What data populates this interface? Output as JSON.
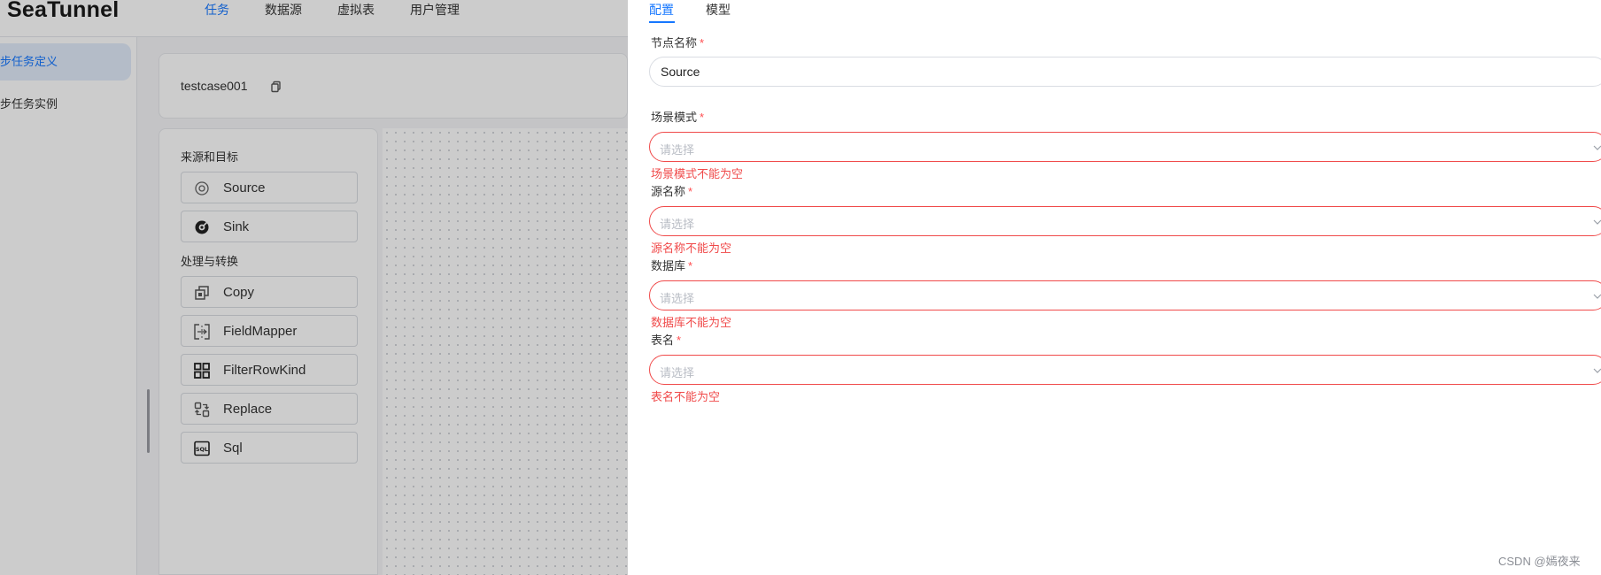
{
  "app": {
    "logo": "SeaTunnel",
    "nav": [
      {
        "label": "任务",
        "active": true
      },
      {
        "label": "数据源",
        "active": false
      },
      {
        "label": "虚拟表",
        "active": false
      },
      {
        "label": "用户管理",
        "active": false
      }
    ],
    "sidebar": [
      {
        "label": "同步任务定义",
        "active": true
      },
      {
        "label": "同步任务实例",
        "active": false
      }
    ],
    "task_name": "testcase001",
    "palette": {
      "group1": "来源和目标",
      "group2": "处理与转换",
      "nodes": [
        {
          "label": "Source",
          "icon": "source-icon"
        },
        {
          "label": "Sink",
          "icon": "sink-icon"
        },
        {
          "label": "Copy",
          "icon": "copy-icon"
        },
        {
          "label": "FieldMapper",
          "icon": "field-mapper-icon"
        },
        {
          "label": "FilterRowKind",
          "icon": "grid-icon"
        },
        {
          "label": "Replace",
          "icon": "replace-icon"
        },
        {
          "label": "Sql",
          "icon": "sql-icon"
        }
      ]
    }
  },
  "drawer": {
    "tabs": [
      {
        "label": "配置",
        "active": true
      },
      {
        "label": "模型",
        "active": false
      }
    ],
    "form": {
      "node_name": {
        "label": "节点名称",
        "required": "*",
        "value": "Source"
      },
      "scene_mode": {
        "label": "场景模式",
        "required": "*",
        "placeholder": "请选择",
        "error": "场景模式不能为空"
      },
      "source_name": {
        "label": "源名称",
        "required": "*",
        "placeholder": "请选择",
        "error": "源名称不能为空"
      },
      "database": {
        "label": "数据库",
        "required": "*",
        "placeholder": "请选择",
        "error": "数据库不能为空"
      },
      "table_name": {
        "label": "表名",
        "required": "*",
        "placeholder": "请选择",
        "error": "表名不能为空"
      }
    }
  },
  "watermark": "CSDN @嫣夜来",
  "colors": {
    "accent": "#1677ff",
    "error": "#f04a4a"
  }
}
